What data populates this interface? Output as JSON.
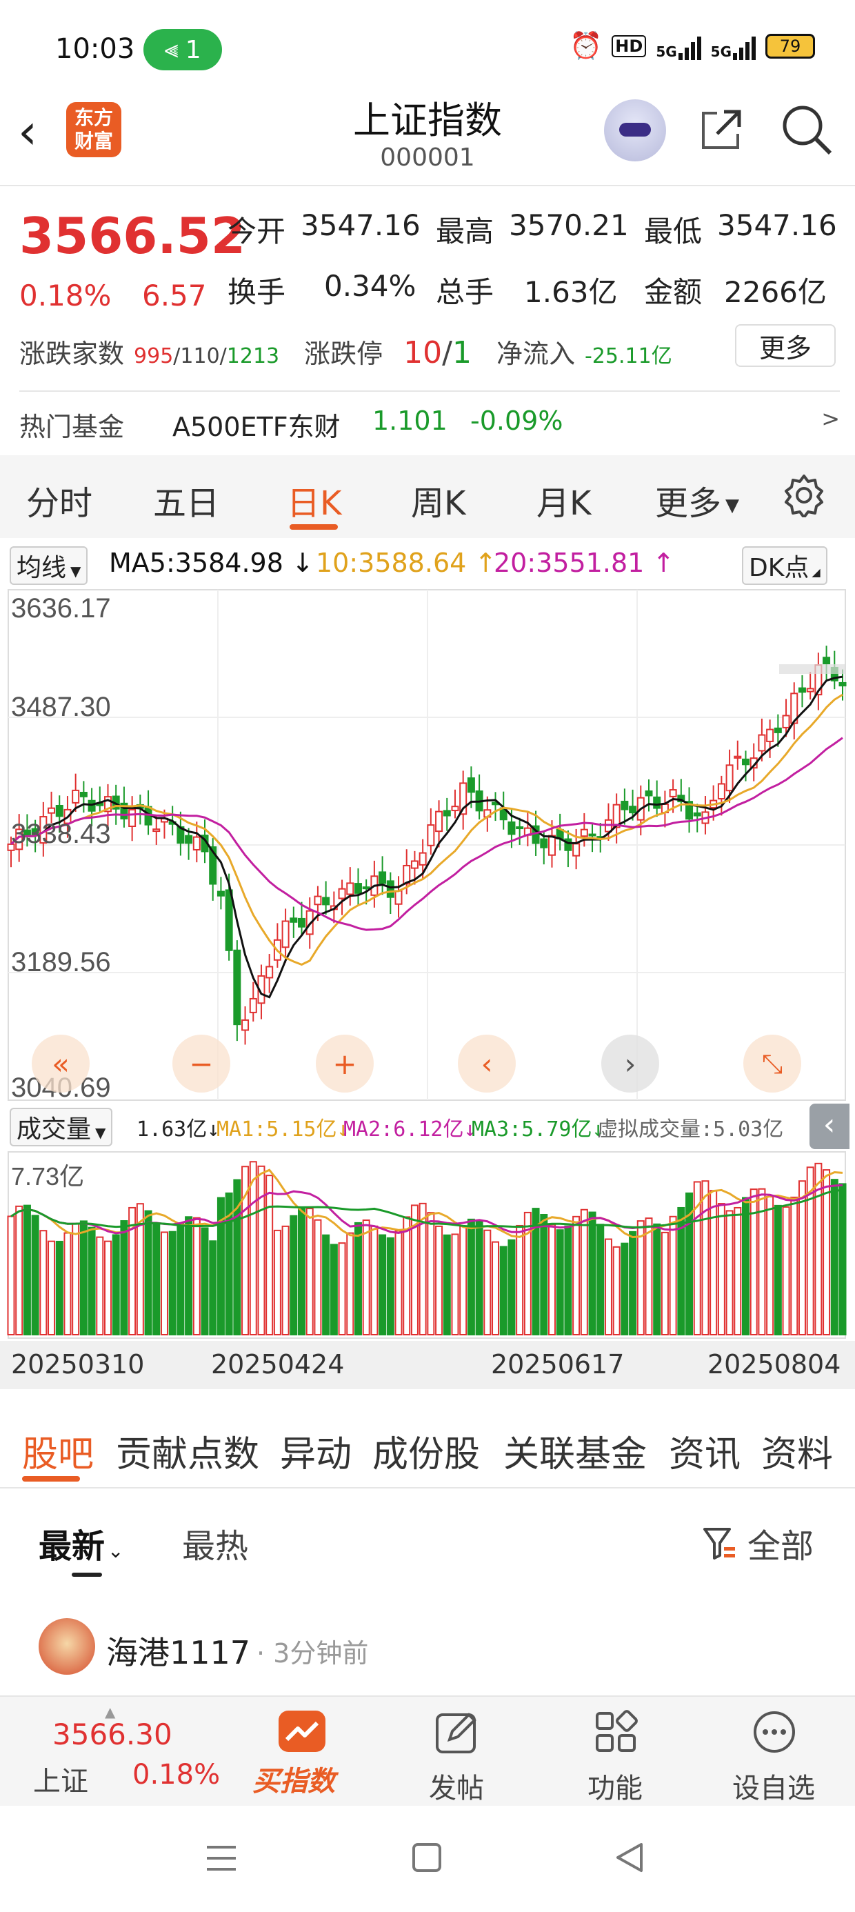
{
  "status_bar": {
    "time": "10:03",
    "wifi_count": "1",
    "hd": "HD",
    "net1": "5G",
    "net2": "5G",
    "battery": "79"
  },
  "header": {
    "logo_line1": "东方",
    "logo_line2": "财富",
    "title": "上证指数",
    "code": "000001"
  },
  "quote": {
    "price": "3566.52",
    "pct": "0.18%",
    "change": "6.57",
    "open_label": "今开",
    "open": "3547.16",
    "high_label": "最高",
    "high": "3570.21",
    "low_label": "最低",
    "low": "3547.16",
    "turnover_label": "换手",
    "turnover": "0.34%",
    "volume_label": "总手",
    "volume": "1.63亿",
    "amount_label": "金额",
    "amount": "2266亿",
    "breadth_label": "涨跌家数",
    "up": "995",
    "flat": "110",
    "down": "1213",
    "limit_label": "涨跌停",
    "limit_up": "10",
    "limit_down": "1",
    "inflow_label": "净流入",
    "inflow": "-25.11亿",
    "more": "更多"
  },
  "hot_fund": {
    "label": "热门基金",
    "name": "A500ETF东财",
    "price": "1.101",
    "pct": "-0.09%",
    "arrow": ">"
  },
  "tabs": {
    "items": [
      "分时",
      "五日",
      "日K",
      "周K",
      "月K",
      "更多"
    ],
    "active": "日K"
  },
  "ma_row": {
    "select": "均线",
    "ma5": "MA5:3584.98",
    "ma10": "10:3588.64",
    "ma20": "20:3551.81",
    "dk": "DK点"
  },
  "chart_axis": {
    "y_labels": [
      "3636.17",
      "3487.30",
      "3338.43",
      "3189.56",
      "3040.69"
    ]
  },
  "volume_row": {
    "select": "成交量",
    "vol": "1.63亿",
    "ma1": "MA1:5.15亿",
    "ma2": "MA2:6.12亿",
    "ma3": "MA3:5.79亿",
    "virtual": "虚拟成交量:5.03亿",
    "max_label": "7.73亿"
  },
  "dates": [
    "20250310",
    "20250424",
    "20250617",
    "20250804"
  ],
  "forum_tabs": {
    "items": [
      "股吧",
      "贡献点数",
      "异动",
      "成份股",
      "关联基金",
      "资讯",
      "资料"
    ],
    "active": "股吧"
  },
  "sort": {
    "latest": "最新",
    "hot": "最热",
    "filter": "全部"
  },
  "post": {
    "user": "海港1117",
    "time": "· 3分钟前"
  },
  "bottom_bar": {
    "price": "3566.30",
    "market": "上证",
    "pct": "0.18%",
    "buy_index": "买指数",
    "post": "发帖",
    "function": "功能",
    "watchlist": "设自选"
  },
  "colors": {
    "accent": "#e95c24",
    "up": "#e03131",
    "down": "#1a9a2a",
    "ma5": "#111111",
    "ma10": "#e8a92a",
    "ma20": "#c21fa0"
  }
}
